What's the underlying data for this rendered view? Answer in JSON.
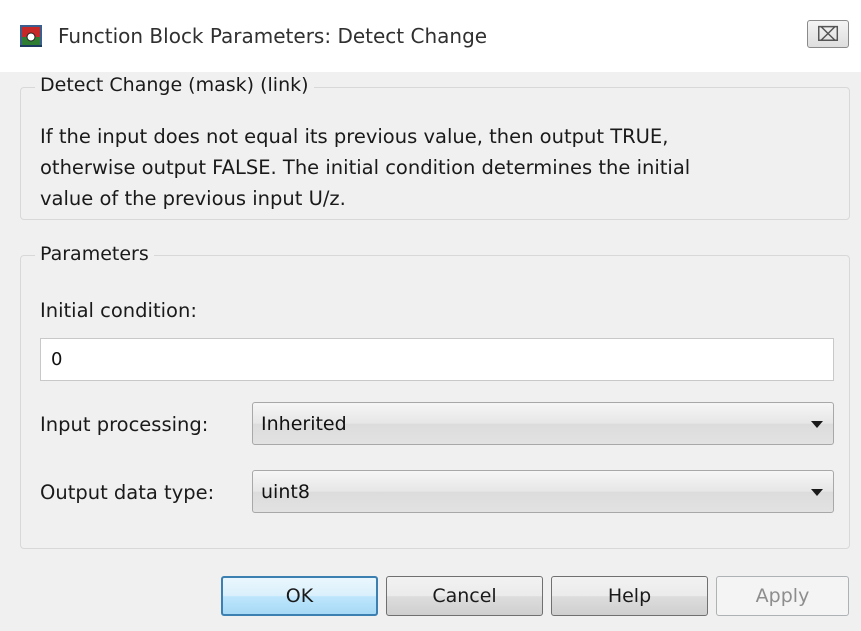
{
  "window": {
    "title": "Function Block Parameters: Detect Change",
    "close_glyph": "⌧",
    "icon": "simulink-block-icon"
  },
  "description": {
    "group_title": "Detect Change (mask) (link)",
    "lines": [
      "If the input does not equal its previous value, then output TRUE,",
      "otherwise output FALSE.  The initial condition determines the initial",
      "value of the previous input U/z."
    ]
  },
  "parameters": {
    "group_title": "Parameters",
    "initial_condition_label": "Initial condition:",
    "initial_condition_value": "0",
    "input_processing_label": "Input processing:",
    "input_processing_value": "Inherited",
    "output_data_type_label": "Output data type:",
    "output_data_type_value": "uint8"
  },
  "buttons": {
    "ok": "OK",
    "cancel": "Cancel",
    "help": "Help",
    "apply": "Apply"
  },
  "colors": {
    "default_button_border": "#3c7fb1",
    "disabled_text": "#8d8d8d"
  }
}
